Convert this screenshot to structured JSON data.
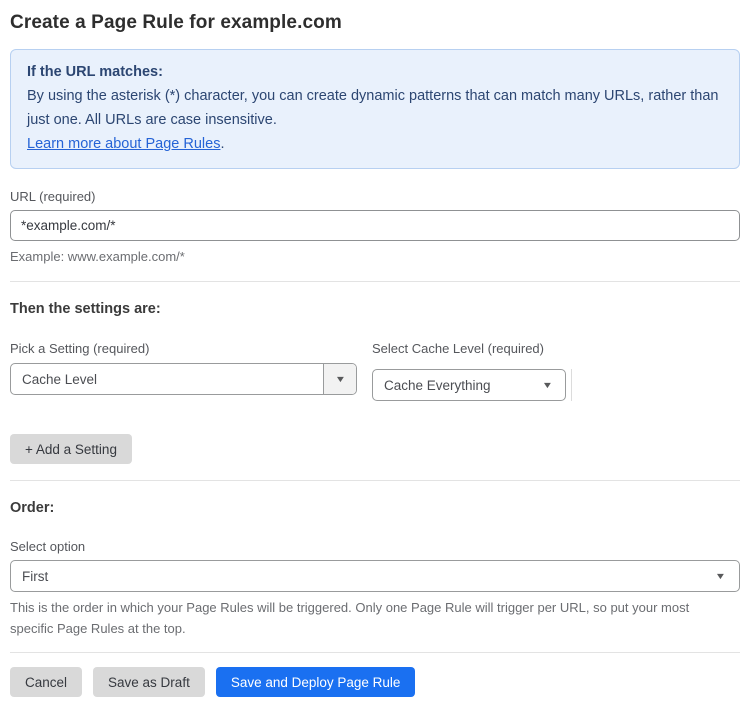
{
  "page": {
    "title": "Create a Page Rule for example.com"
  },
  "info_box": {
    "heading": "If the URL matches:",
    "body": "By using the asterisk (*) character, you can create dynamic patterns that can match many URLs, rather than just one. All URLs are case insensitive.",
    "link_label": "Learn more about Page Rules",
    "link_suffix": "."
  },
  "url_field": {
    "label": "URL (required)",
    "value": "*example.com/*",
    "helper": "Example: www.example.com/*"
  },
  "settings_section": {
    "heading": "Then the settings are:",
    "setting_picker": {
      "label": "Pick a Setting (required)",
      "value": "Cache Level"
    },
    "cache_level_picker": {
      "label": "Select Cache Level (required)",
      "value": "Cache Everything"
    },
    "add_setting_label": "+ Add a Setting"
  },
  "order_section": {
    "heading": "Order:",
    "label": "Select option",
    "value": "First",
    "helper": "This is the order in which your Page Rules will be triggered. Only one Page Rule will trigger per URL, so put your most specific Page Rules at the top."
  },
  "actions": {
    "cancel_label": "Cancel",
    "save_draft_label": "Save as Draft",
    "save_deploy_label": "Save and Deploy Page Rule"
  },
  "icons": {
    "dropdown_arrow": "▼"
  },
  "colors": {
    "primary_blue": "#1a70f1",
    "info_bg": "#e9f1fc",
    "info_border": "#b7d0f1",
    "info_text": "#2c4672",
    "link_blue": "#2563d6",
    "button_gray": "#d9d9d9"
  }
}
